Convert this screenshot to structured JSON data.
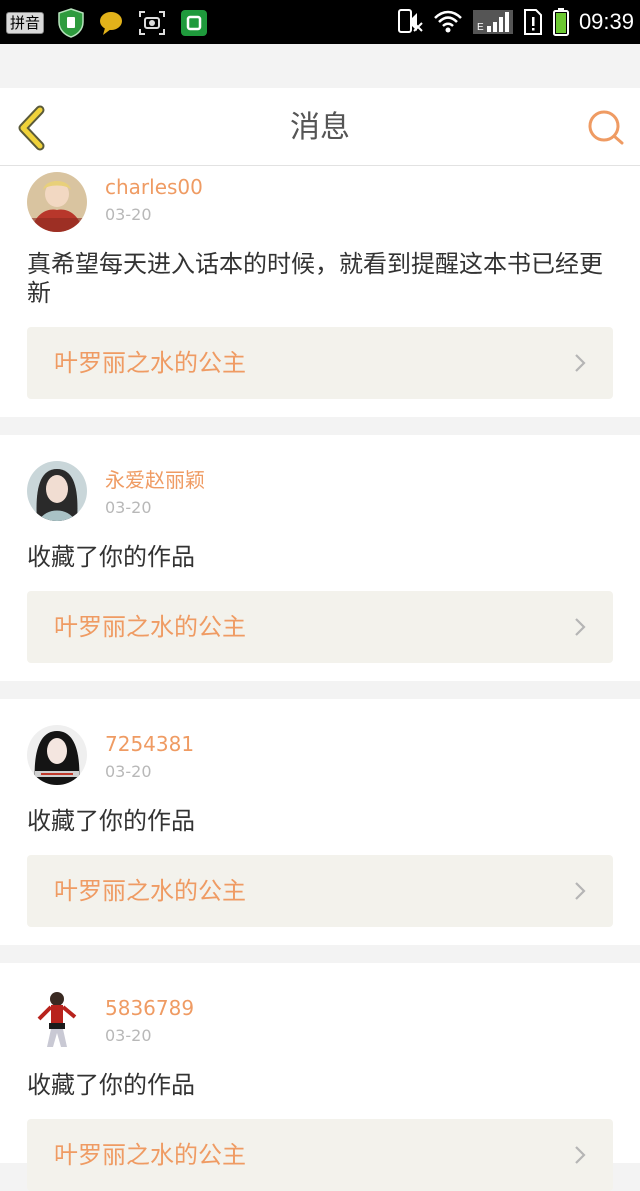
{
  "status_bar": {
    "ime_label": "拼音",
    "time": "09:39",
    "icons": [
      "shield-icon",
      "chat-bubble-icon",
      "screenshot-icon",
      "app-icon",
      "mute-icon",
      "wifi-icon",
      "signal-icon",
      "sim-alert-icon",
      "battery-icon"
    ],
    "network_label": "E"
  },
  "header": {
    "title": "消息",
    "back_icon": "chevron-left-icon",
    "search_icon": "search-icon",
    "accent_color": "#ef9b63",
    "back_color": "#f0d23a"
  },
  "messages": [
    {
      "username": "charles00",
      "date": "03-20",
      "text": "真希望每天进入话本的时候，就看到提醒这本书已经更新",
      "work_title": "叶罗丽之水的公主",
      "avatar_icon": "avatar-image"
    },
    {
      "username": "永爱赵丽颖",
      "date": "03-20",
      "text": "收藏了你的作品",
      "work_title": "叶罗丽之水的公主",
      "avatar_icon": "avatar-image"
    },
    {
      "username": "7254381",
      "date": "03-20",
      "text": "收藏了你的作品",
      "work_title": "叶罗丽之水的公主",
      "avatar_icon": "avatar-image"
    },
    {
      "username": "5836789",
      "date": "03-20",
      "text": "收藏了你的作品",
      "work_title": "叶罗丽之水的公主",
      "avatar_icon": "avatar-image"
    }
  ]
}
